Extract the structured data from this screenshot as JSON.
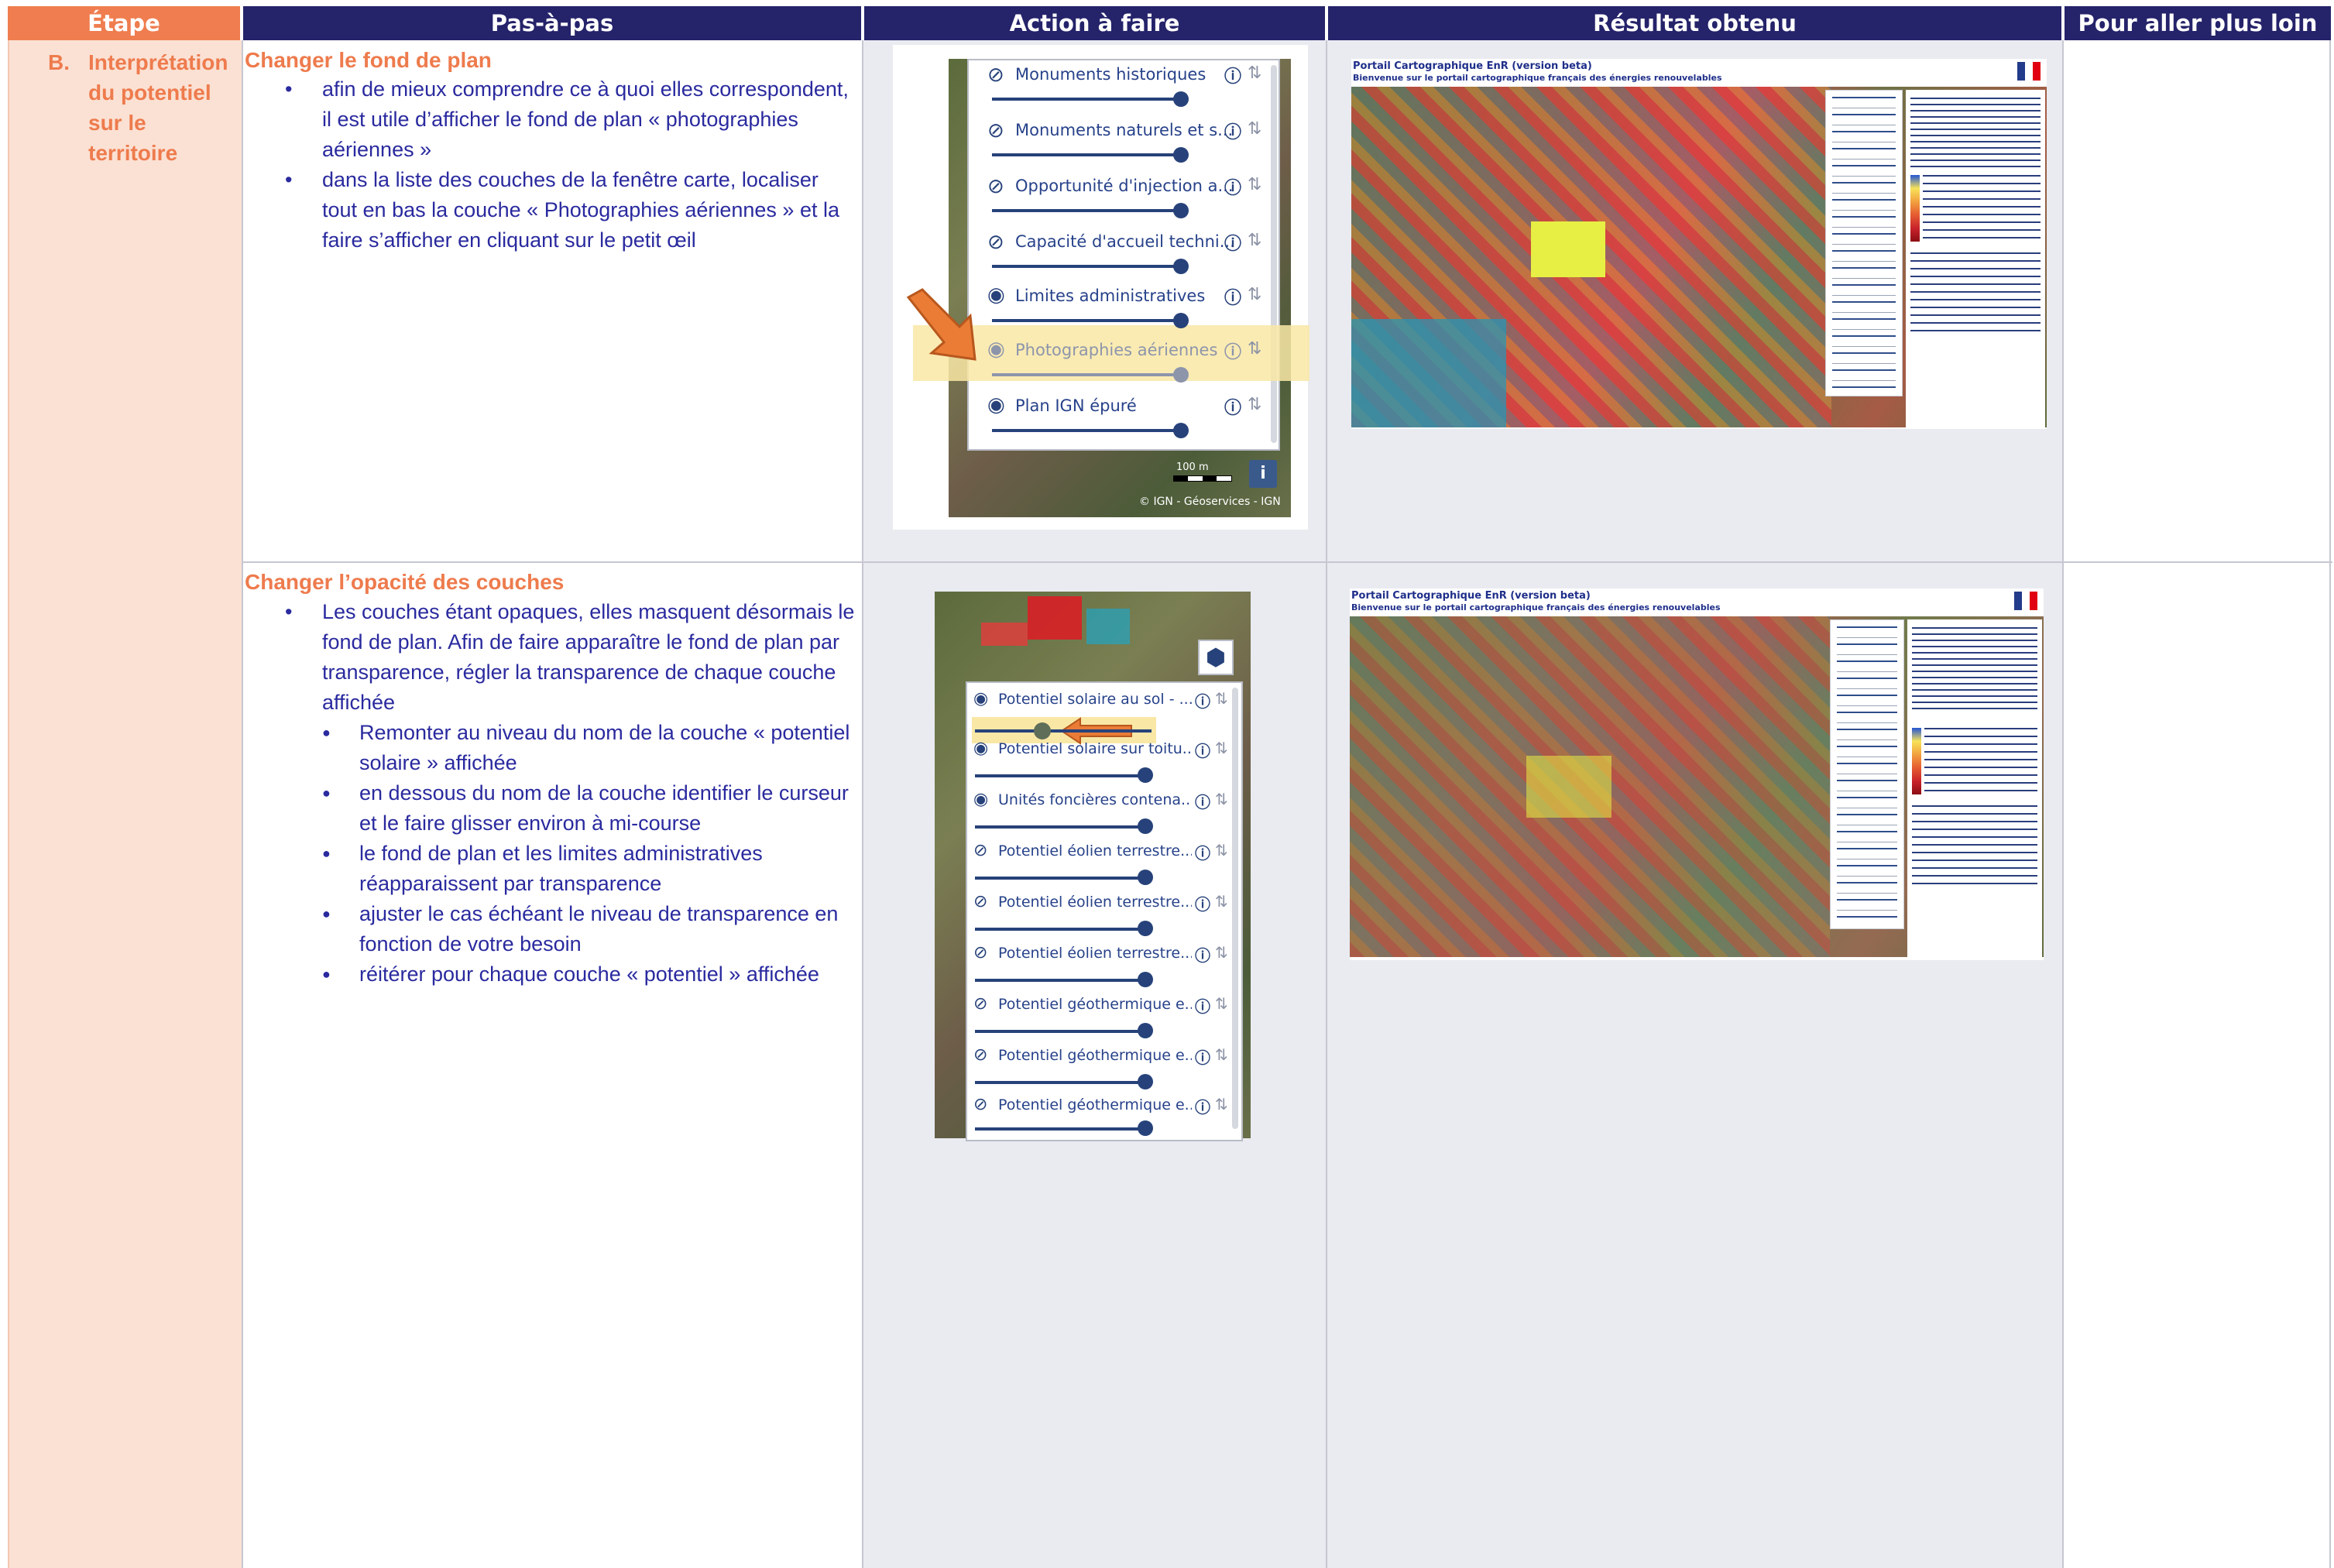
{
  "headers": {
    "etape": "Étape",
    "pas": "Pas-à-pas",
    "action": "Action à faire",
    "resultat": "Résultat obtenu",
    "plus_loin": "Pour aller plus loin"
  },
  "etape": {
    "marker": "B.",
    "lines": [
      "Interprétation",
      "du potentiel",
      "sur le",
      "territoire"
    ]
  },
  "step1": {
    "title": "Changer le fond de plan",
    "bullets": [
      "afin de mieux comprendre ce à quoi elles correspondent, il est utile d’afficher le fond de plan « photographies aériennes »",
      "dans la liste des couches de la fenêtre carte, localiser tout en bas la couche « Photographies aériennes » et la faire s’afficher en cliquant sur le petit œil"
    ],
    "layers": [
      "Monuments historiques",
      "Monuments naturels et s...",
      "Opportunité d'injection a...",
      "Capacité d'accueil techni...",
      "Limites administratives",
      "Photographies aériennes",
      "Plan IGN épuré"
    ],
    "scale": "100 m",
    "info_btn": "i",
    "attribution": "© IGN - Géoservices - IGN"
  },
  "step2": {
    "title": "Changer l’opacité des couches",
    "intro": "Les couches étant opaques, elles masquent désormais le fond de plan. Afin de faire apparaître le fond de plan par transparence, régler la transparence de chaque couche affichée",
    "sub_bullets": [
      "Remonter au niveau du nom de la couche « potentiel solaire » affichée",
      "en dessous du nom de la couche identifier le curseur et le faire glisser environ à mi-course",
      "le fond de plan et les limites administratives réapparaissent par transparence",
      "ajuster le cas échéant le niveau de transparence en fonction de votre besoin",
      "réitérer pour chaque couche « potentiel » affichée"
    ],
    "layers": [
      "Potentiel solaire au sol - ...",
      "Potentiel solaire sur toitu...",
      "Unités foncières contena...",
      "Potentiel éolien terrestre...",
      "Potentiel éolien terrestre...",
      "Potentiel éolien terrestre...",
      "Potentiel géothermique e...",
      "Potentiel géothermique e...",
      "Potentiel géothermique e..."
    ]
  },
  "result": {
    "title": "Portail Cartographique EnR (version beta)",
    "subtitle": "Bienvenue sur le portail cartographique français des énergies renouvelables"
  },
  "colors": {
    "header_navy": "#25236a",
    "header_orange": "#ef7d4f",
    "etape_bg": "#fbe1d4",
    "grey_bg": "#e9ebf0",
    "highlight": "#f9e7a6",
    "arrow": "#ea7c36",
    "accent_text": "#ee7b4d",
    "body_text": "#2a2a9f"
  }
}
